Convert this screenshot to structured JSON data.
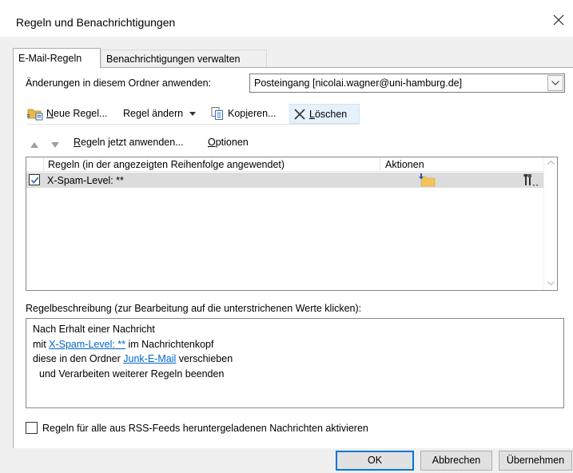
{
  "window": {
    "title": "Regeln und Benachrichtigungen"
  },
  "tabs": [
    {
      "label": "E-Mail-Regeln",
      "active": true
    },
    {
      "label": "Benachrichtigungen verwalten",
      "active": false
    }
  ],
  "apply_folder": {
    "label": "Änderungen in diesem Ordner anwenden:",
    "selected": "Posteingang [nicolai.wagner@uni-hamburg.de]"
  },
  "toolbar": {
    "new_rule_pre": "N",
    "new_rule_mn": "",
    "new_rule_rest": "eue Regel...",
    "change_rule_pre": "Re",
    "change_rule_mn": "g",
    "change_rule_rest": "el ändern",
    "copy_pre": "Kop",
    "copy_mn": "i",
    "copy_rest": "eren...",
    "delete_pre": "",
    "delete_mn": "L",
    "delete_rest": "öschen"
  },
  "actions_row": {
    "apply_now_pre": "",
    "apply_now_mn": "R",
    "apply_now_rest": "egeln jetzt anwenden...",
    "options_pre": "",
    "options_mn": "O",
    "options_rest": "ptionen"
  },
  "rules_table": {
    "columns": [
      "Regeln (in der angezeigten Reihenfolge angewendet)",
      "Aktionen"
    ],
    "rows": [
      {
        "name": "X-Spam-Level: **",
        "checked": true
      }
    ]
  },
  "description": {
    "label": "Regelbeschreibung (zur Bearbeitung auf die unterstrichenen Werte klicken):",
    "line1": "Nach Erhalt einer Nachricht",
    "line2_pre": "mit ",
    "line2_link": "X-Spam-Level: **",
    "line2_post": " im Nachrichtenkopf",
    "line3_pre": "diese in den Ordner ",
    "line3_link": "Junk-E-Mail",
    "line3_post": " verschieben",
    "line4": "und Verarbeiten weiterer Regeln beenden"
  },
  "rss": {
    "label": "Regeln für alle aus RSS-Feeds heruntergeladenen Nachrichten aktivieren",
    "checked": false
  },
  "buttons": {
    "ok": "OK",
    "cancel": "Abbrechen",
    "apply": "Übernehmen"
  },
  "colors": {
    "link": "#0066cc",
    "selection": "#dcdcdc",
    "default_border": "#0078d7"
  },
  "icons": {
    "new_rule": "new-rule-icon",
    "copy": "copy-icon",
    "delete": "delete-x-icon",
    "move_up": "arrow-up-icon",
    "move_down": "arrow-down-icon",
    "folder": "folder-move-icon",
    "tools": "tools-icon"
  }
}
